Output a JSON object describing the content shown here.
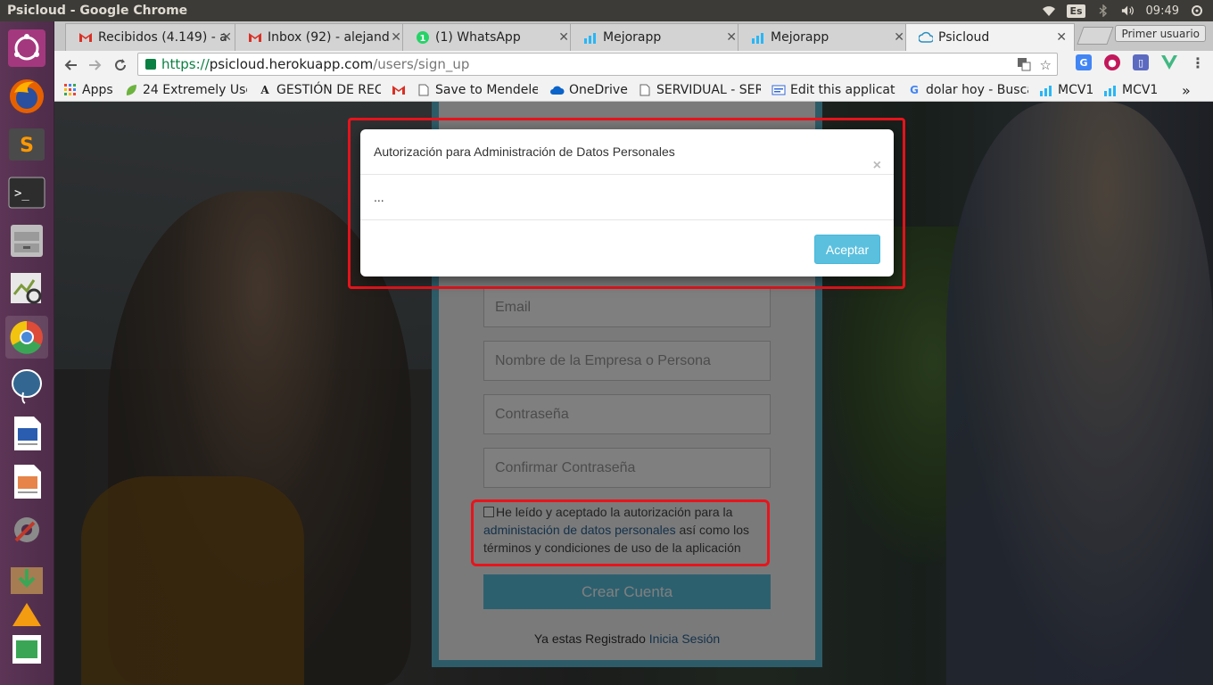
{
  "os": {
    "window_title": "Psicloud - Google Chrome",
    "keyboard_layout": "Es",
    "clock": "09:49",
    "user": "Primer usuario",
    "launcher_colors": [
      "#e95420",
      "#e66000",
      "#6b6b6b",
      "#2d2d2d",
      "#bdbdbd",
      "#7c9a3a",
      "#dd4b39",
      "#336791",
      "#2a5db0",
      "#e6844a",
      "#8a8a8a",
      "#a67c52",
      "#f39c12",
      "#3aa655"
    ]
  },
  "browser": {
    "tabs": [
      {
        "label": "Recibidos (4.149) - a",
        "icon": "gmail-icon"
      },
      {
        "label": "Inbox (92) - alejand",
        "icon": "gmail-icon"
      },
      {
        "label": "(1) WhatsApp",
        "icon": "whatsapp-icon"
      },
      {
        "label": "Mejorapp",
        "icon": "mejorapp-icon"
      },
      {
        "label": "Mejorapp",
        "icon": "mejorapp-icon"
      },
      {
        "label": "Psicloud",
        "icon": "psicloud-icon"
      }
    ],
    "url": {
      "scheme": "https://",
      "host": "psicloud.herokuapp.com",
      "path": "/users/sign_up"
    },
    "bookmarks": [
      {
        "label": "Apps",
        "icon": "apps-icon"
      },
      {
        "label": "24 Extremely Use",
        "icon": "leaf-icon"
      },
      {
        "label": "GESTIÓN DE REC",
        "icon": "letter-a-icon"
      },
      {
        "label": "",
        "icon": "gmail-icon"
      },
      {
        "label": "Save to Mendeley",
        "icon": "page-icon"
      },
      {
        "label": "OneDrive",
        "icon": "cloud-icon"
      },
      {
        "label": "SERVIDUAL - SER",
        "icon": "page-icon"
      },
      {
        "label": "Edit this applicat",
        "icon": "edit-icon"
      },
      {
        "label": "dolar hoy - Busca",
        "icon": "google-icon"
      },
      {
        "label": "MCV1",
        "icon": "chart-icon"
      },
      {
        "label": "MCV1",
        "icon": "chart-icon"
      }
    ],
    "bookmarks_overflow": "»"
  },
  "page": {
    "form": {
      "email_placeholder": "Email",
      "company_placeholder": "Nombre de la Empresa o Persona",
      "password_placeholder": "Contraseña",
      "confirm_placeholder": "Confirmar Contraseña",
      "terms_prefix": "He leído y aceptado la autorización para la",
      "terms_link": "administación de datos personales",
      "terms_suffix": "así como los términos y condiciones de uso de la aplicación",
      "submit": "Crear Cuenta",
      "already_registered": "Ya estas Registrado",
      "login_link": "Inicia Sesión"
    },
    "modal": {
      "title": "Autorización para Administración de Datos Personales",
      "close": "×",
      "body": "...",
      "accept": "Aceptar"
    }
  }
}
